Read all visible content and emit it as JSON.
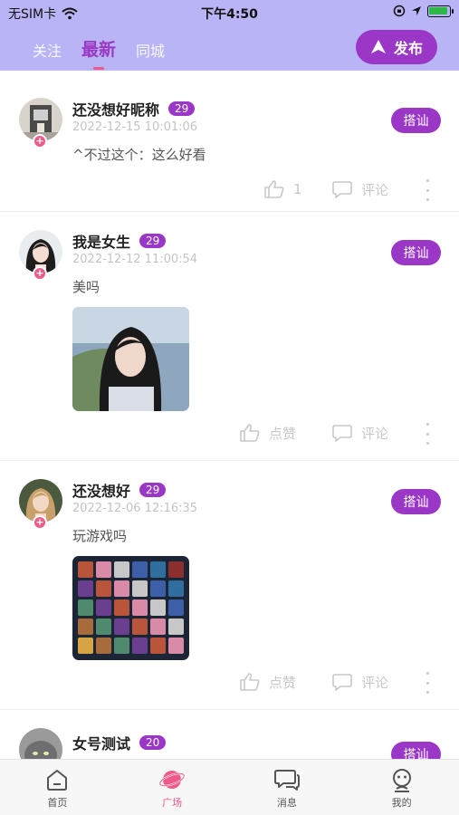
{
  "status_bar": {
    "carrier": "无SIM卡",
    "time": "下午4:50"
  },
  "top_tabs": [
    {
      "label": "关注",
      "active": false
    },
    {
      "label": "最新",
      "active": true
    },
    {
      "label": "同城",
      "active": false
    }
  ],
  "publish_label": "发布",
  "chat_label": "搭讪",
  "comment_label": "评论",
  "like_label": "点赞",
  "posts": [
    {
      "username": "还没想好昵称",
      "age": "29",
      "time": "2022-12-15 10:01:06",
      "text": "^不过这个：这么好看",
      "likes": "1"
    },
    {
      "username": "我是女生",
      "age": "29",
      "time": "2022-12-12 11:00:54",
      "text": "美吗"
    },
    {
      "username": "还没想好",
      "age": "29",
      "time": "2022-12-06 12:16:35",
      "text": "玩游戏吗"
    },
    {
      "username": "女号测试",
      "age": "20"
    }
  ],
  "bottom_nav": [
    {
      "label": "首页",
      "icon": "home-icon",
      "active": false
    },
    {
      "label": "广场",
      "icon": "planet-icon",
      "active": true
    },
    {
      "label": "消息",
      "icon": "message-icon",
      "active": false
    },
    {
      "label": "我的",
      "icon": "profile-icon",
      "active": false
    }
  ],
  "colors": {
    "header_bg": "#b9b4f5",
    "accent_purple": "#9b37c6",
    "accent_pink": "#ef5a8a",
    "muted_gray": "#c8c8c8"
  }
}
